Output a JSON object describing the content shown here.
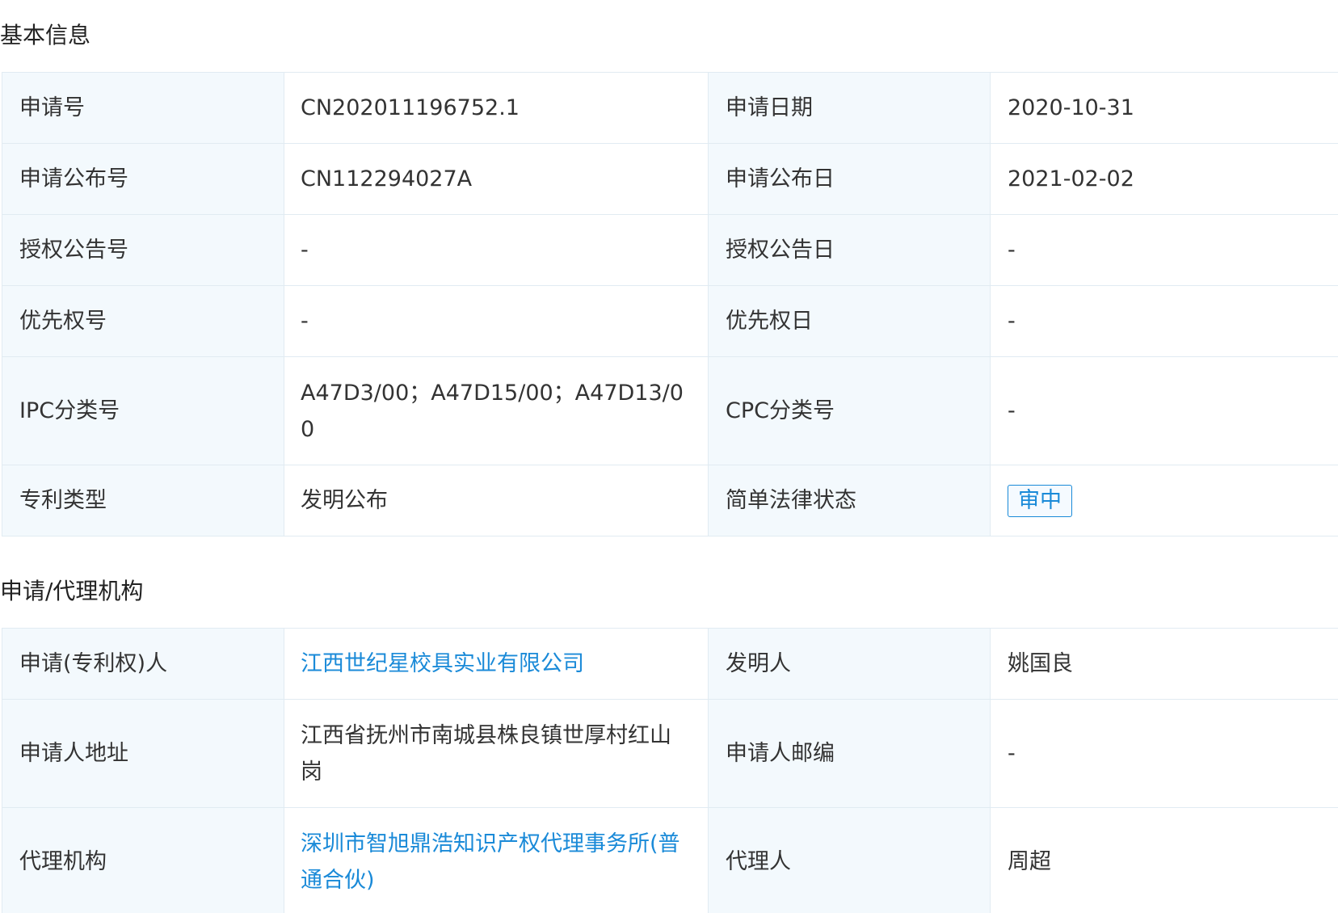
{
  "basic_info": {
    "title": "基本信息",
    "rows": [
      {
        "label1": "申请号",
        "value1": "CN202011196752.1",
        "label2": "申请日期",
        "value2": "2020-10-31"
      },
      {
        "label1": "申请公布号",
        "value1": "CN112294027A",
        "label2": "申请公布日",
        "value2": "2021-02-02"
      },
      {
        "label1": "授权公告号",
        "value1": "-",
        "label2": "授权公告日",
        "value2": "-"
      },
      {
        "label1": "优先权号",
        "value1": "-",
        "label2": "优先权日",
        "value2": "-"
      },
      {
        "label1": "IPC分类号",
        "value1": "A47D3/00；A47D15/00；A47D13/00",
        "label2": "CPC分类号",
        "value2": "-"
      },
      {
        "label1": "专利类型",
        "value1": "发明公布",
        "label2": "简单法律状态",
        "value2": "审中"
      }
    ]
  },
  "agency": {
    "title": "申请/代理机构",
    "rows": [
      {
        "label1": "申请(专利权)人",
        "value1": "江西世纪星校具实业有限公司",
        "label2": "发明人",
        "value2": "姚国良"
      },
      {
        "label1": "申请人地址",
        "value1": "江西省抚州市南城县株良镇世厚村红山岗",
        "label2": "申请人邮编",
        "value2": "-"
      },
      {
        "label1": "代理机构",
        "value1": "深圳市智旭鼎浩知识产权代理事务所(普通合伙)",
        "label2": "代理人",
        "value2": "周超"
      }
    ]
  },
  "colors": {
    "label_bg": "#f3f9fd",
    "border": "#e1ebf2",
    "link": "#1a8ad8",
    "text": "#333333"
  }
}
